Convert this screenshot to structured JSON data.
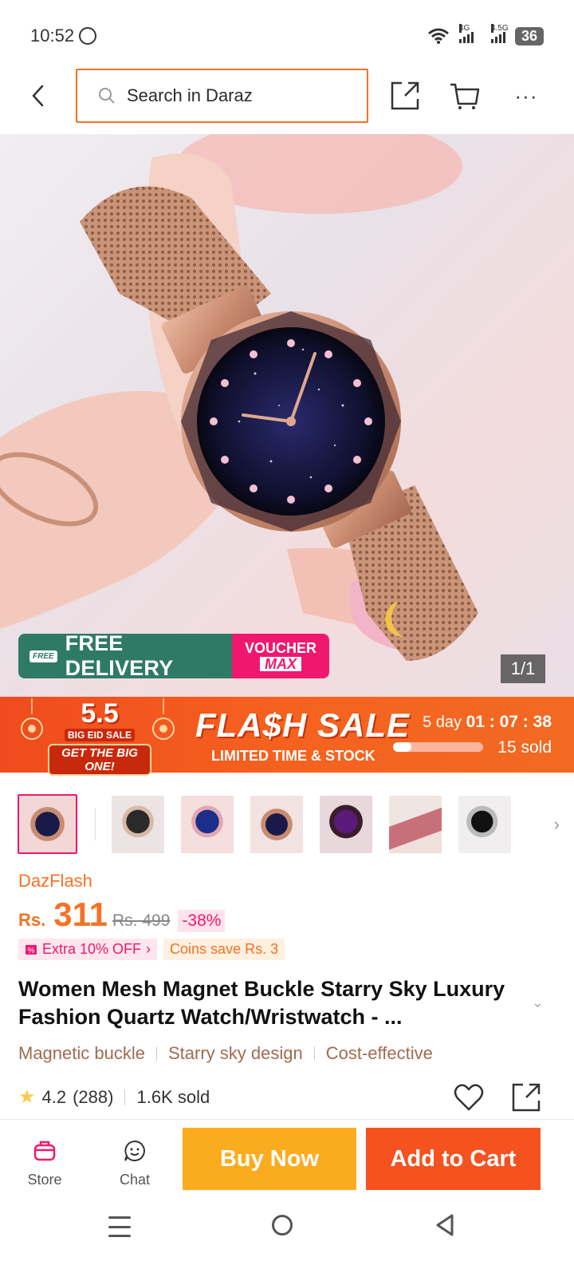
{
  "status": {
    "time": "10:52",
    "net1": "4G",
    "net2": "4.5G",
    "battery": "36"
  },
  "search": {
    "placeholder": "Search in Daraz"
  },
  "image": {
    "free_delivery_tag": "FREE",
    "free_delivery": "FREE DELIVERY",
    "voucher_top": "VOUCHER",
    "voucher_bottom": "MAX",
    "counter": "1/1"
  },
  "flash": {
    "eid_number": "5.5",
    "eid_sub": "BIG EID SALE",
    "eid_btn": "GET THE BIG ONE!",
    "title": "FLA$H SALE",
    "subtitle": "LIMITED TIME & STOCK",
    "days": "5 day",
    "countdown": "01 : 07 : 38",
    "sold": "15 sold",
    "progress": 0.2
  },
  "product": {
    "store": "DazFlash",
    "currency": "Rs.",
    "price": "311",
    "old_price": "Rs. 499",
    "discount": "-38%",
    "promo_extra": "Extra 10% OFF",
    "promo_coins": "Coins save Rs. 3",
    "title": "Women Mesh Magnet Buckle Starry Sky Luxury Fashion Quartz Watch/Wristwatch - ...",
    "features": [
      "Magnetic buckle",
      "Starry sky design",
      "Cost-effective"
    ],
    "rating": "4.2",
    "reviews": "(288)",
    "sold": "1.6K sold"
  },
  "bottom_bar": {
    "store": "Store",
    "chat": "Chat",
    "buy_now": "Buy Now",
    "add_to_cart": "Add to Cart"
  },
  "colors": {
    "brand_orange": "#f57224",
    "buy_now": "#fbac1e",
    "add_to_cart": "#f5521f",
    "pink": "#f0186e"
  }
}
